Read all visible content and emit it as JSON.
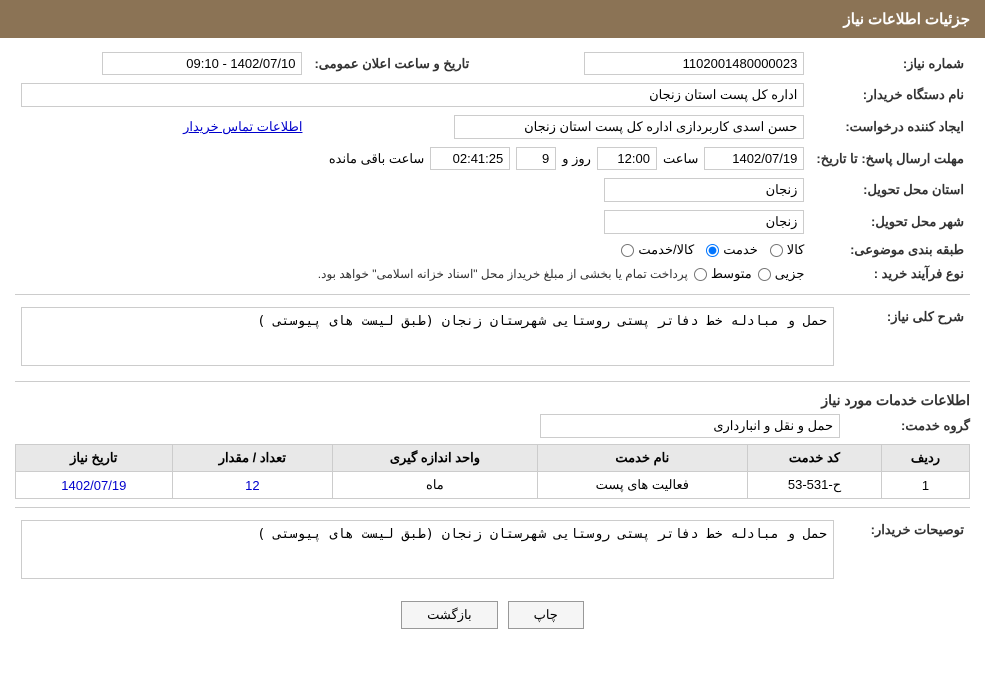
{
  "header": {
    "title": "جزئیات اطلاعات نیاز"
  },
  "form": {
    "need_number_label": "شماره نیاز:",
    "need_number_value": "1102001480000023",
    "date_label": "تاریخ و ساعت اعلان عمومی:",
    "date_value": "1402/07/10 - 09:10",
    "buyer_org_label": "نام دستگاه خریدار:",
    "buyer_org_value": "اداره کل پست استان زنجان",
    "creator_label": "ایجاد کننده درخواست:",
    "creator_value": "حسن  اسدی کاربردازی اداره کل پست استان زنجان",
    "contact_link": "اطلاعات تماس خریدار",
    "deadline_label": "مهلت ارسال پاسخ: تا تاریخ:",
    "deadline_date": "1402/07/19",
    "deadline_time_label": "ساعت",
    "deadline_time": "12:00",
    "deadline_days_label": "روز و",
    "deadline_days": "9",
    "deadline_remaining_label": "ساعت باقی مانده",
    "deadline_remaining": "02:41:25",
    "province_label": "استان محل تحویل:",
    "province_value": "زنجان",
    "city_label": "شهر محل تحویل:",
    "city_value": "زنجان",
    "category_label": "طبقه بندی موضوعی:",
    "category_options": [
      "کالا",
      "خدمت",
      "کالا/خدمت"
    ],
    "category_selected": "خدمت",
    "purchase_type_label": "نوع فرآیند خرید :",
    "purchase_type_options": [
      "جزیی",
      "متوسط"
    ],
    "purchase_type_note": "پرداخت تمام یا بخشی از مبلغ خریداز محل \"اسناد خزانه اسلامی\" خواهد بود.",
    "need_description_label": "شرح کلی نیاز:",
    "need_description_value": "حمل و مبادله خط دفاتر پستی روستایی شهرستان زنجان (طبق لیست های پیوستی )"
  },
  "services_section": {
    "title": "اطلاعات خدمات مورد نیاز",
    "group_label": "گروه خدمت:",
    "group_value": "حمل و نقل و انبارداری",
    "table": {
      "headers": [
        "ردیف",
        "کد خدمت",
        "نام خدمت",
        "واحد اندازه گیری",
        "تعداد / مقدار",
        "تاریخ نیاز"
      ],
      "rows": [
        {
          "row": "1",
          "code": "ح-531-53",
          "name": "فعالیت های پست",
          "unit": "ماه",
          "quantity": "12",
          "date": "1402/07/19"
        }
      ]
    }
  },
  "buyer_description_label": "توصیحات خریدار:",
  "buyer_description_value": "حمل و مبادله خط دفاتر پستی روستایی شهرستان زنجان (طبق لیست های پیوستی )",
  "buttons": {
    "print": "چاپ",
    "back": "بازگشت"
  }
}
